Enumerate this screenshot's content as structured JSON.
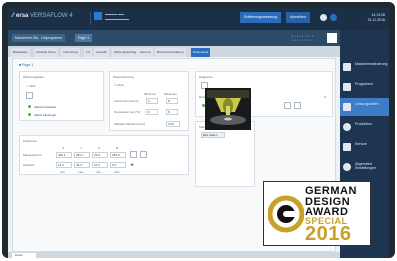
{
  "topbar": {
    "app_title": "ersa",
    "app_subtitle": "VERSAFLOW 4",
    "status_button": "Entfernungsmessung",
    "user_button": "Anmelden",
    "clock_time": "14:13:28",
    "clock_date": "01.11.2016"
  },
  "toolbar": {
    "button1": "Maschinen-Status",
    "button2": "Lötprogramm",
    "button3": "Page 1"
  },
  "tabs": [
    "Basisdaten",
    "Lötstelle Fluxer",
    "Vorheizung",
    "Lot",
    "Lötwelle",
    "Wartungsauftrag",
    "Kamera",
    "Benutzerverwaltung",
    "Dokumente"
  ],
  "active_tab": "Dokumente",
  "sidebar": {
    "items": [
      {
        "label": "Maschinensteuerung",
        "icon": "machine-icon"
      },
      {
        "label": "Programme",
        "icon": "program-icon"
      },
      {
        "label": "Leistungsdaten",
        "icon": "wave-icon"
      },
      {
        "label": "Produktion",
        "icon": "production-icon"
      },
      {
        "label": "Service",
        "icon": "service-icon"
      },
      {
        "label": "Allgemeine Einstellungen",
        "icon": "settings-icon"
      }
    ],
    "active_index": 2
  },
  "content": {
    "section_title": "Page 1",
    "left_panel": {
      "title": "Werkzeugdaten",
      "item1": "Aktiv",
      "dot1": "Aktives Fluxbeet",
      "dot2": "Aktive Fluxtiegel"
    },
    "mid_panel": {
      "title": "Parametrierung",
      "checkbox_label": "Aktiv",
      "col1": "Minimum",
      "col2": "Maximum",
      "row1_label": "Lötzeit Prozess [s]",
      "row1_v1": "0",
      "row1_v2": "8",
      "row2_label": "Temperatur Lot [°C]",
      "row2_v1": "0",
      "row2_v2": "8",
      "row3_label": "Hilfswert-Abstand [mm]",
      "row3_v1": "0.00"
    },
    "coords_panel": {
      "title": "Positionen",
      "headers": [
        "X",
        "Y",
        "Z",
        "R"
      ],
      "row1_label": "Messpunkt Ist",
      "row1_values": [
        "460.1",
        "281.7",
        "23.8",
        "250.8"
      ],
      "row2_label": "Abstand",
      "row2_values": [
        "12.4",
        "46.4",
        "10.3",
        "0.3"
      ],
      "row3_values": [
        "min",
        "max",
        "min",
        "max"
      ]
    },
    "right_panel": {
      "title1": "Diagramm",
      "title2": "Reflowsetup",
      "dot_label": "Aktiviert",
      "camera_title": "Kamera",
      "camera_button": "Bild Halten"
    }
  },
  "award": {
    "line1": "GERMAN",
    "line2": "DESIGN",
    "line3": "AWARD",
    "line4": "SPECIAL",
    "year": "2016"
  },
  "footer": {
    "button": "Zurück"
  },
  "colors": {
    "accent": "#2b6dbf",
    "topbar": "#1b3047",
    "sidebar": "#1d3550",
    "award_gold": "#c8a12a"
  }
}
